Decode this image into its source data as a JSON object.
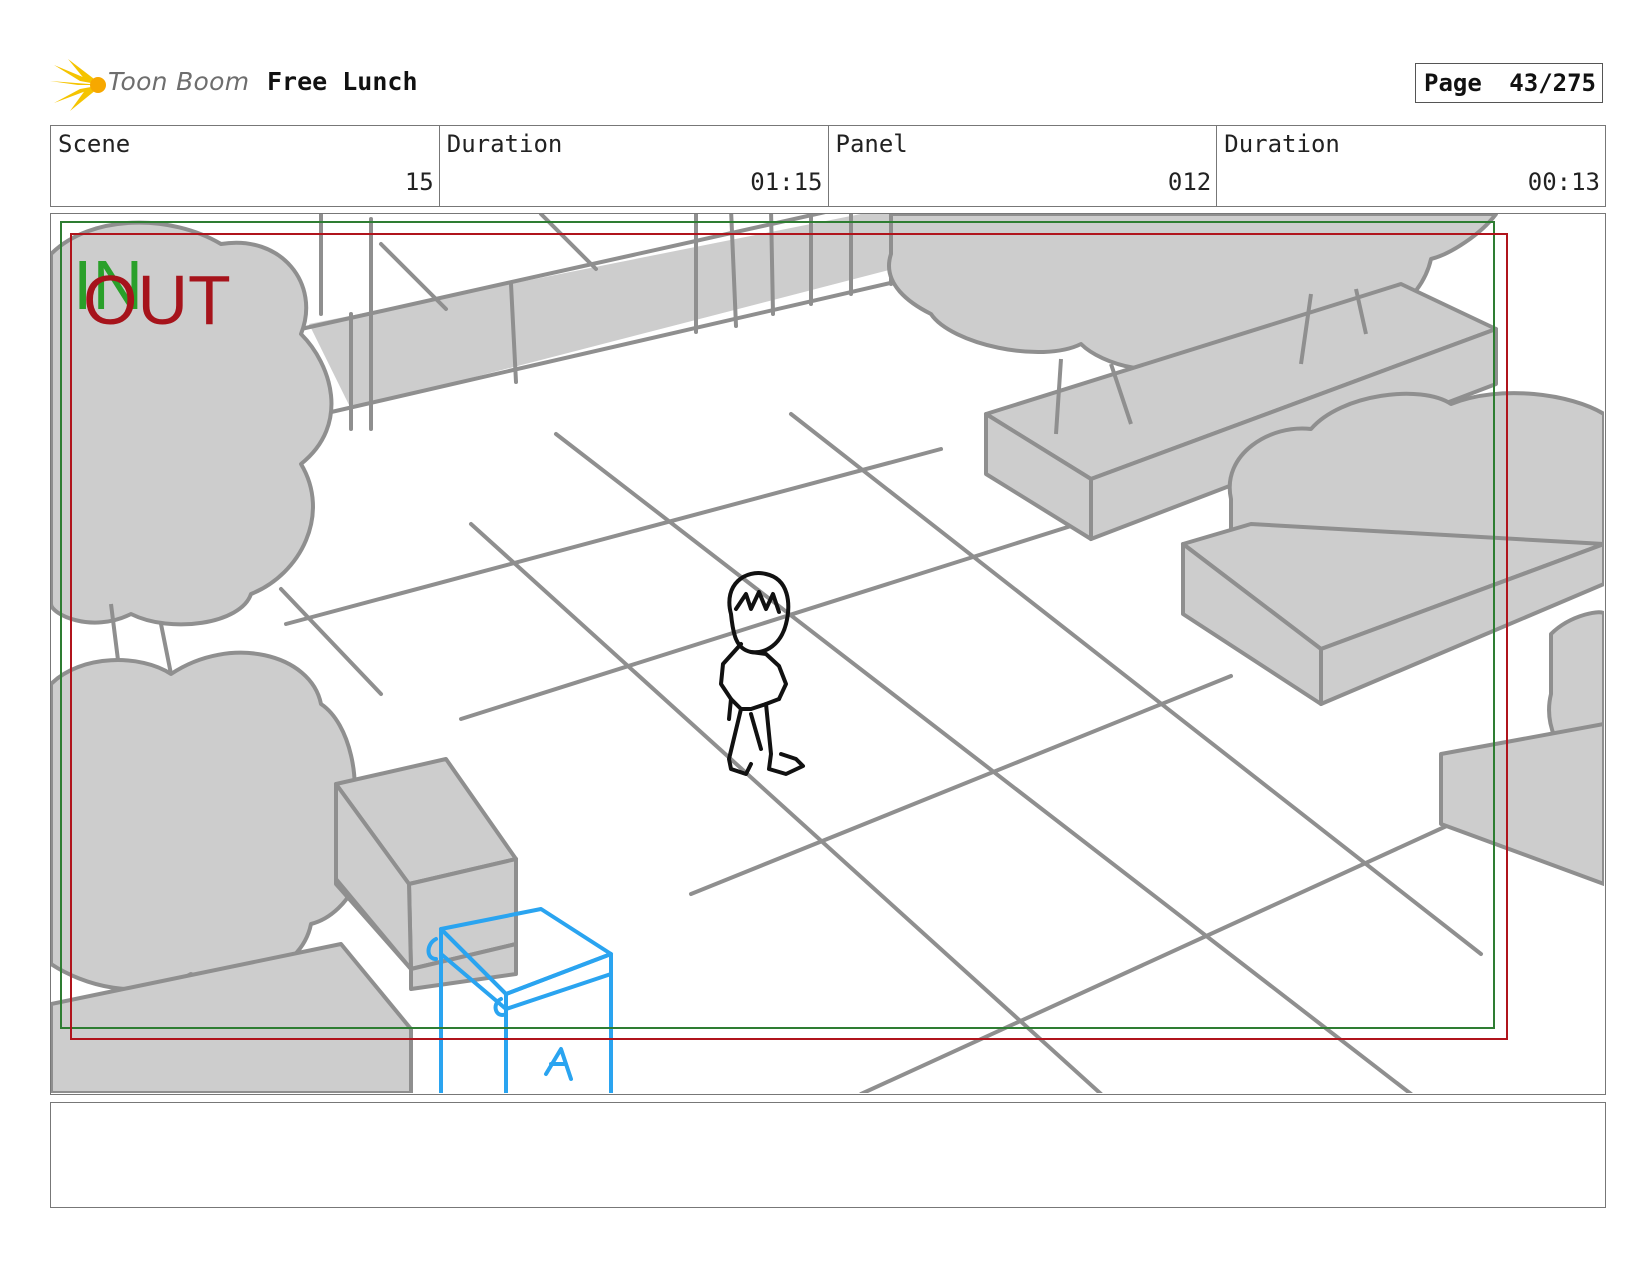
{
  "header": {
    "logo_text": "Toon Boom",
    "project_title": "Free Lunch",
    "page_label": "Page",
    "page_number": "43/275"
  },
  "info": {
    "scene_label": "Scene",
    "scene_value": "15",
    "scene_duration_label": "Duration",
    "scene_duration_value": "01:15",
    "panel_label": "Panel",
    "panel_value": "012",
    "panel_duration_label": "Duration",
    "panel_duration_value": "00:13"
  },
  "panel": {
    "in_marker": "IN",
    "out_marker": "OUT"
  },
  "colors": {
    "in_frame": "#2e7d32",
    "out_frame": "#b0141c",
    "sketch_gray": "#8f8f8f",
    "fill_gray": "#cdcdcd",
    "blue_sketch": "#2aa4f0"
  },
  "notes": {
    "text": ""
  }
}
